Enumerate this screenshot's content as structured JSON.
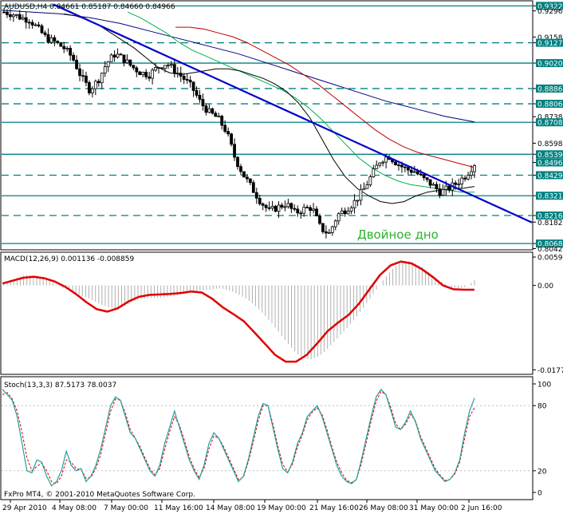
{
  "chart_data": [
    {
      "type": "candlestick",
      "header": "AUDUSD,H4  0.84661 0.85187 0.84660 0.84966",
      "annotation": "Двойное дно",
      "price_axis": {
        "ylim": [
          0.804,
          0.9345
        ],
        "ticks": [
          "0.93224",
          "0.92960",
          "0.91580",
          "0.91279",
          "0.90206",
          "0.88865",
          "0.88060",
          "0.87380",
          "0.87083",
          "0.85980",
          "0.85397",
          "0.84966",
          "0.84295",
          "0.83211",
          "0.82167",
          "0.81820",
          "0.80688",
          "0.80420"
        ],
        "tick_values": [
          0.93224,
          0.9296,
          0.9158,
          0.91279,
          0.90206,
          0.88865,
          0.8806,
          0.8738,
          0.87083,
          0.8598,
          0.85397,
          0.84966,
          0.84295,
          0.83211,
          0.82167,
          0.8182,
          0.80688,
          0.8042
        ],
        "highlighted": [
          "0.93224",
          "0.91279",
          "0.90206",
          "0.88865",
          "0.88060",
          "0.87083",
          "0.85397",
          "0.84966",
          "0.84295",
          "0.83211",
          "0.82167",
          "0.80688"
        ]
      },
      "levels": [
        {
          "value": 0.93224,
          "style": "solid"
        },
        {
          "value": 0.91279,
          "style": "dashed"
        },
        {
          "value": 0.90206,
          "style": "solid"
        },
        {
          "value": 0.88865,
          "style": "dashed"
        },
        {
          "value": 0.8806,
          "style": "dashed"
        },
        {
          "value": 0.87083,
          "style": "solid"
        },
        {
          "value": 0.85397,
          "style": "solid"
        },
        {
          "value": 0.84295,
          "style": "dashed"
        },
        {
          "value": 0.83211,
          "style": "solid"
        },
        {
          "value": 0.82167,
          "style": "dashed"
        },
        {
          "value": 0.80688,
          "style": "solid"
        }
      ],
      "trendline": {
        "from": [
          0,
          0.933
        ],
        "to": [
          1,
          0.818
        ]
      },
      "close_path": [
        0.929,
        0.928,
        0.926,
        0.925,
        0.92,
        0.915,
        0.913,
        0.91,
        0.905,
        0.895,
        0.888,
        0.893,
        0.902,
        0.907,
        0.904,
        0.9,
        0.897,
        0.896,
        0.9,
        0.902,
        0.898,
        0.894,
        0.889,
        0.881,
        0.876,
        0.873,
        0.866,
        0.852,
        0.843,
        0.836,
        0.829,
        0.824,
        0.826,
        0.828,
        0.823,
        0.825,
        0.826,
        0.815,
        0.812,
        0.822,
        0.825,
        0.829,
        0.835,
        0.843,
        0.851,
        0.853,
        0.849,
        0.846,
        0.845,
        0.841,
        0.838,
        0.834,
        0.836,
        0.839,
        0.843,
        0.849
      ],
      "ma_fast": [
        0.928,
        0.927,
        0.925,
        0.922,
        0.918,
        0.914,
        0.91,
        0.905,
        0.9,
        0.897,
        0.896,
        0.897,
        0.898,
        0.899,
        0.899,
        0.898,
        0.896,
        0.894,
        0.891,
        0.887,
        0.881,
        0.873,
        0.862,
        0.851,
        0.842,
        0.836,
        0.832,
        0.829,
        0.828,
        0.829,
        0.832,
        0.834,
        0.835,
        0.836,
        0.836,
        0.837
      ],
      "ma_mid": [
        0.929,
        0.926,
        0.922,
        0.918,
        0.913,
        0.909,
        0.906,
        0.903,
        0.9,
        0.897,
        0.894,
        0.891,
        0.888,
        0.884,
        0.879,
        0.873,
        0.866,
        0.859,
        0.852,
        0.847,
        0.843,
        0.84,
        0.838,
        0.837,
        0.836,
        0.835,
        0.834,
        0.834
      ],
      "ma_slow": [
        0.921,
        0.921,
        0.92,
        0.918,
        0.916,
        0.913,
        0.909,
        0.905,
        0.901,
        0.896,
        0.891,
        0.885,
        0.879,
        0.873,
        0.867,
        0.862,
        0.858,
        0.855,
        0.853,
        0.851,
        0.849,
        0.847
      ],
      "ma_long": [
        0.93,
        0.929,
        0.928,
        0.926,
        0.923,
        0.919,
        0.915,
        0.911,
        0.907,
        0.902,
        0.897,
        0.892,
        0.887,
        0.882,
        0.878,
        0.874,
        0.871
      ]
    },
    {
      "type": "histogram+line",
      "header": "MACD(12,26,9) 0.001136 -0.008859",
      "ylim": [
        -0.0185,
        0.0068
      ],
      "ticks": [
        "0.005954",
        "0.00",
        "-0.017724"
      ],
      "tick_values": [
        0.005954,
        0.0,
        -0.017724
      ],
      "histogram": [
        0.0005,
        0.0012,
        0.0018,
        0.0022,
        0.0021,
        0.0017,
        0.001,
        0.0002,
        -0.0006,
        -0.0012,
        -0.0019,
        -0.0025,
        -0.0032,
        -0.004,
        -0.0046,
        -0.0048,
        -0.0044,
        -0.0036,
        -0.003,
        -0.0027,
        -0.0026,
        -0.0026,
        -0.0024,
        -0.0021,
        -0.0018,
        -0.0015,
        -0.0012,
        -0.001,
        -0.0008,
        -0.0006,
        -0.001,
        -0.0016,
        -0.0024,
        -0.0034,
        -0.0048,
        -0.0064,
        -0.0082,
        -0.0102,
        -0.0122,
        -0.014,
        -0.0152,
        -0.0156,
        -0.015,
        -0.0138,
        -0.0122,
        -0.0105,
        -0.0088,
        -0.007,
        -0.005,
        -0.0028,
        -0.0006,
        0.0016,
        0.0034,
        0.0046,
        0.0052,
        0.0048,
        0.0038,
        0.0026,
        0.0014,
        0.0004,
        -0.0004,
        -0.0006,
        -0.0002,
        0.0011
      ],
      "signal": [
        0.0004,
        0.001,
        0.0016,
        0.0018,
        0.0015,
        0.0008,
        -0.0003,
        -0.0018,
        -0.0035,
        -0.005,
        -0.0055,
        -0.0048,
        -0.0034,
        -0.0024,
        -0.002,
        -0.0019,
        -0.0018,
        -0.0016,
        -0.0013,
        -0.0015,
        -0.0028,
        -0.0046,
        -0.006,
        -0.0075,
        -0.0098,
        -0.0122,
        -0.0146,
        -0.016,
        -0.016,
        -0.0146,
        -0.0122,
        -0.0096,
        -0.0078,
        -0.0062,
        -0.0038,
        -0.0008,
        0.0022,
        0.0042,
        0.005,
        0.0046,
        0.0034,
        0.0018,
        0.0,
        -0.0008,
        -0.0009,
        -0.0009
      ]
    },
    {
      "type": "line",
      "header": "Stoch(13,3,3) 87.5173 78.0037",
      "ylim": [
        0,
        100
      ],
      "ticks": [
        "100",
        "80",
        "20",
        "0"
      ],
      "tick_values": [
        100,
        80,
        20,
        0
      ],
      "main": [
        95,
        90,
        85,
        70,
        45,
        20,
        18,
        30,
        28,
        15,
        6,
        10,
        20,
        38,
        25,
        20,
        22,
        10,
        15,
        25,
        40,
        60,
        80,
        88,
        85,
        70,
        55,
        50,
        40,
        30,
        20,
        15,
        25,
        45,
        60,
        75,
        60,
        45,
        30,
        20,
        12,
        25,
        45,
        55,
        50,
        40,
        30,
        20,
        10,
        15,
        30,
        50,
        70,
        82,
        80,
        60,
        40,
        22,
        18,
        28,
        45,
        55,
        70,
        75,
        80,
        70,
        55,
        40,
        25,
        15,
        10,
        8,
        12,
        30,
        50,
        70,
        88,
        95,
        90,
        75,
        60,
        58,
        65,
        75,
        65,
        50,
        40,
        30,
        20,
        15,
        10,
        12,
        18,
        30,
        55,
        75,
        87
      ],
      "signal": [
        90,
        92,
        86,
        75,
        55,
        32,
        20,
        24,
        27,
        20,
        10,
        8,
        15,
        30,
        28,
        22,
        21,
        13,
        14,
        22,
        35,
        55,
        75,
        86,
        85,
        73,
        58,
        50,
        42,
        32,
        22,
        16,
        22,
        40,
        56,
        70,
        62,
        48,
        33,
        22,
        14,
        22,
        40,
        52,
        50,
        42,
        32,
        22,
        12,
        14,
        28,
        46,
        66,
        80,
        80,
        63,
        43,
        26,
        19,
        26,
        42,
        53,
        67,
        74,
        78,
        72,
        58,
        42,
        28,
        18,
        11,
        9,
        12,
        27,
        46,
        66,
        84,
        93,
        90,
        78,
        63,
        58,
        63,
        72,
        66,
        52,
        42,
        32,
        22,
        16,
        11,
        12,
        17,
        28,
        50,
        70,
        78
      ]
    },
    {
      "type": "time_axis",
      "labels": [
        "29 Apr 2010",
        "4 May 08:00",
        "7 May 00:00",
        "11 May 16:00",
        "14 May 08:00",
        "19 May 00:00",
        "21 May 16:00",
        "26 May 08:00",
        "31 May 00:00",
        "2 Jun 16:00"
      ]
    }
  ],
  "copyright": "FxPro MT4, © 2001-2010 MetaQuotes Software Corp.",
  "colors": {
    "trend": "#0000cc",
    "levels": "#008080",
    "macd_signal": "#e00000",
    "macd_hist": "#b0b0b0",
    "stoch_main": "#20a0a0",
    "stoch_signal": "#e00000",
    "annotation": "#2ab52a",
    "ma_fast": "#000000",
    "ma_mid": "#00b050",
    "ma_slow": "#c00000",
    "ma_long": "#000080"
  }
}
